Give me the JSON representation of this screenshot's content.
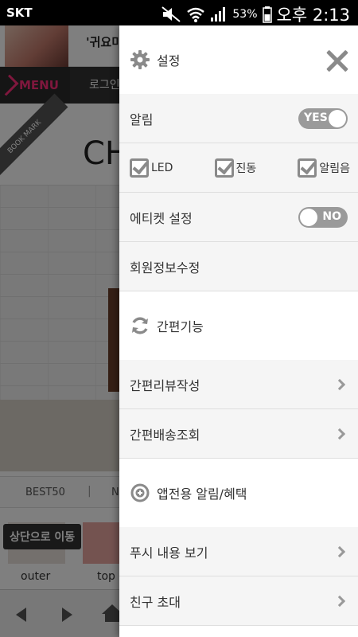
{
  "status_bar": {
    "carrier": "SKT",
    "battery": "53%",
    "time": "오후 2:13"
  },
  "background_page": {
    "banner_text": "'귀요미",
    "menu_label": "MENU",
    "login_label": "로그인",
    "bookmark_label": "BOOK MARK",
    "title_fragment": "CH",
    "tab_best": "BEST50",
    "tab_sep": "|",
    "tab_next": "N",
    "scroll_top_button": "상단으로 이동",
    "categories": [
      "outer",
      "top"
    ]
  },
  "drawer": {
    "settings": {
      "title": "설정",
      "icon": "gear-icon",
      "close_icon": "close-icon"
    },
    "notification": {
      "label": "알림",
      "toggle": "YES"
    },
    "checkboxes": [
      {
        "label": "LED",
        "checked": true
      },
      {
        "label": "진동",
        "checked": true
      },
      {
        "label": "알림음",
        "checked": true
      }
    ],
    "etiquette": {
      "label": "에티켓 설정",
      "toggle": "NO"
    },
    "member_info": "회원정보수정",
    "easy": {
      "title": "간편기능",
      "icon": "refresh-icon",
      "items": [
        "간편리뷰작성",
        "간편배송조회"
      ]
    },
    "app_benefits": {
      "title": "앱전용 알림/혜택",
      "icon": "target-plus-icon",
      "items": [
        "푸시 내용 보기",
        "친구 초대"
      ]
    }
  },
  "colors": {
    "drawer_row_bg": "#f5f5f5",
    "toggle_bg": "#9a9a9a",
    "icon_gray": "#8a8a8a",
    "menu_pink": "#ff2f7a"
  }
}
